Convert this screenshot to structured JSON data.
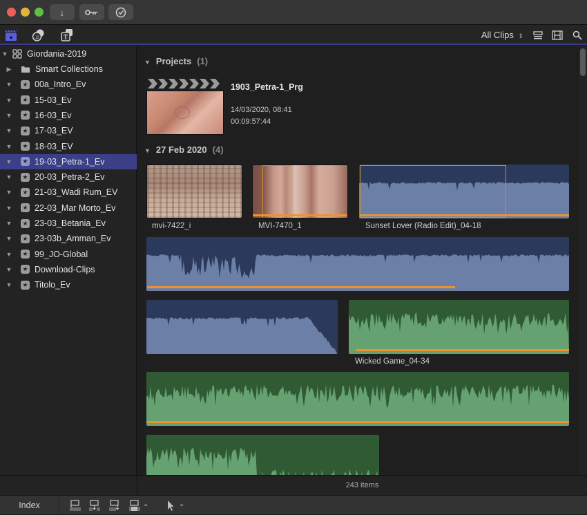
{
  "window": {
    "traffic_lights": {
      "close": "#ec5f57",
      "minimize": "#e0b53c",
      "zoom": "#5fbe45"
    },
    "toolbar_buttons": [
      {
        "name": "import-button",
        "icon": "arrow-down-icon",
        "glyph": "↓"
      },
      {
        "name": "keywords-button",
        "icon": "key-icon",
        "glyph": "⚷"
      },
      {
        "name": "background-tasks-button",
        "icon": "checkmark-circle-icon",
        "glyph": "✓"
      }
    ]
  },
  "browser_toolbar": {
    "tabs": [
      {
        "name": "libraries-tab",
        "icon": "clapperboard-star-icon",
        "active": true
      },
      {
        "name": "photos-audio-tab",
        "icon": "photos-music-icon",
        "active": false
      },
      {
        "name": "titles-generators-tab",
        "icon": "titles-icon",
        "active": false
      }
    ],
    "filter_label": "All Clips",
    "filter_chevron": "⌃⌄"
  },
  "sidebar": {
    "library": {
      "label": "Giordania-2019",
      "expanded": true
    },
    "items": [
      {
        "label": "Smart Collections",
        "type": "folder",
        "expanded": false,
        "selected": false
      },
      {
        "label": "00a_Intro_Ev",
        "type": "event",
        "expanded": true,
        "selected": false
      },
      {
        "label": "15-03_Ev",
        "type": "event",
        "expanded": true,
        "selected": false
      },
      {
        "label": "16-03_Ev",
        "type": "event",
        "expanded": true,
        "selected": false
      },
      {
        "label": "17-03_EV",
        "type": "event",
        "expanded": true,
        "selected": false
      },
      {
        "label": "18-03_EV",
        "type": "event",
        "expanded": true,
        "selected": false
      },
      {
        "label": "19-03_Petra-1_Ev",
        "type": "event",
        "expanded": true,
        "selected": true
      },
      {
        "label": "20-03_Petra-2_Ev",
        "type": "event",
        "expanded": true,
        "selected": false
      },
      {
        "label": "21-03_Wadi Rum_EV",
        "type": "event",
        "expanded": true,
        "selected": false
      },
      {
        "label": "22-03_Mar Morto_Ev",
        "type": "event",
        "expanded": true,
        "selected": false
      },
      {
        "label": "23-03_Betania_Ev",
        "type": "event",
        "expanded": true,
        "selected": false
      },
      {
        "label": "23-03b_Amman_Ev",
        "type": "event",
        "expanded": true,
        "selected": false
      },
      {
        "label": "99_JO-Global",
        "type": "event",
        "expanded": true,
        "selected": false
      },
      {
        "label": "Download-Clips",
        "type": "event",
        "expanded": true,
        "selected": false
      },
      {
        "label": "Titolo_Ev",
        "type": "event",
        "expanded": true,
        "selected": false
      }
    ]
  },
  "browser": {
    "projects_section": {
      "title": "Projects",
      "count": "(1)"
    },
    "project": {
      "name": "1903_Petra-1_Prg",
      "date": "14/03/2020, 08:41",
      "duration": "00:09:57:44"
    },
    "date_section": {
      "title": "27 Feb 2020",
      "count": "(4)"
    },
    "clips": [
      {
        "name": "mvi-7422_i",
        "kind": "video"
      },
      {
        "name": "MVI-7470_1",
        "kind": "video",
        "favorite_range": true
      },
      {
        "name": "Sunset Lover (Radio Edit)_04-18",
        "kind": "audio-blue",
        "favorite_range": true
      },
      {
        "name": "Wicked Game_04-34",
        "kind": "audio-green",
        "favorite_range": true
      }
    ],
    "status": "243 items"
  },
  "bottom_bar": {
    "index_label": "Index",
    "edit_buttons": [
      "connect-clip-icon",
      "insert-clip-icon",
      "append-clip-icon",
      "overwrite-clip-icon"
    ],
    "tool_select": "arrow-pointer-icon"
  },
  "colors": {
    "accent": "#3a3f88",
    "favorite": "#f0922c",
    "audio_blue_dark": "#2b3a5a",
    "audio_blue_light": "#6c7fa6",
    "audio_green_dark": "#2f5a33",
    "audio_green_light": "#66a172"
  }
}
